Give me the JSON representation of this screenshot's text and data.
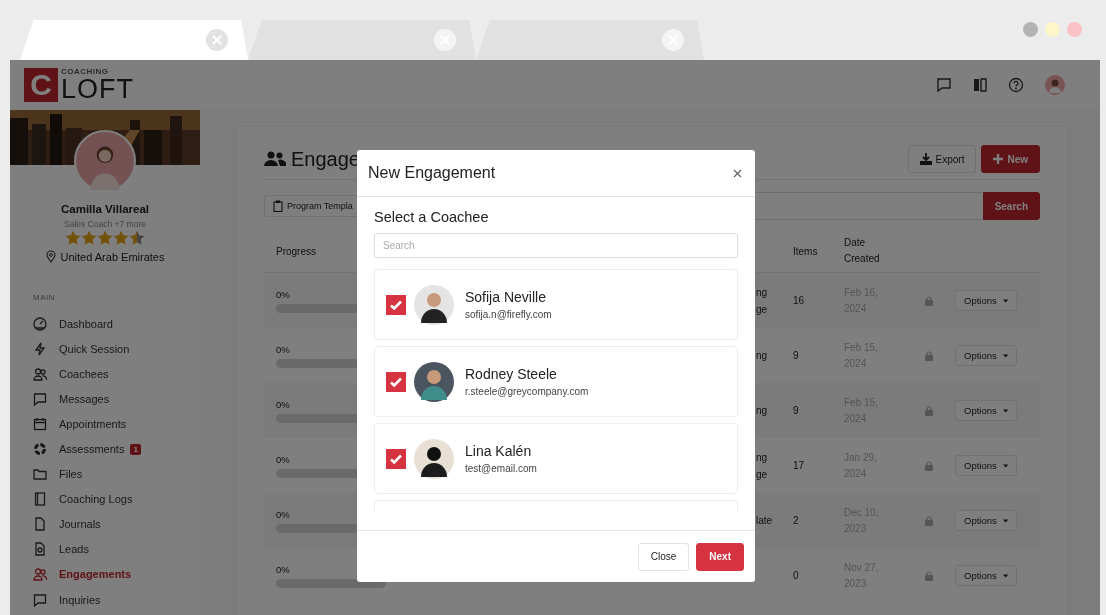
{
  "browser": {
    "tabs": [
      {
        "selected": true
      },
      {
        "selected": false
      },
      {
        "selected": false
      }
    ]
  },
  "logo": {
    "mark": "C",
    "top": "COACHING",
    "bottom": "LOFT"
  },
  "profile": {
    "name": "Camilla Villareal",
    "role": "Sales Coach +7 more",
    "stars": 4.5,
    "location": "United Arab Emirates"
  },
  "sidebar": {
    "section": "MAIN",
    "items": [
      {
        "label": "Dashboard",
        "selected": false
      },
      {
        "label": "Quick Session",
        "selected": false
      },
      {
        "label": "Coachees",
        "selected": false
      },
      {
        "label": "Messages",
        "selected": false
      },
      {
        "label": "Appointments",
        "selected": false
      },
      {
        "label": "Assessments",
        "selected": false,
        "badge": "1"
      },
      {
        "label": "Files",
        "selected": false
      },
      {
        "label": "Coaching Logs",
        "selected": false
      },
      {
        "label": "Journals",
        "selected": false
      },
      {
        "label": "Leads",
        "selected": false
      },
      {
        "label": "Engagements",
        "selected": true
      },
      {
        "label": "Inquiries",
        "selected": false
      }
    ]
  },
  "page": {
    "title": "Engage",
    "export": "Export",
    "new": "New",
    "template_button": "Program Templa",
    "search_button": "Search",
    "columns": {
      "progress": "Progress",
      "items": "Items",
      "date": "Date Created"
    },
    "rows": [
      {
        "progress": "0%",
        "level": 0,
        "column_3": [
          "ng",
          "ge"
        ],
        "items": "16",
        "date": "Feb 16, 2024",
        "options": "Options"
      },
      {
        "progress": "0%",
        "level": 0,
        "column_3": [
          "ng"
        ],
        "items": "9",
        "date": "Feb 15, 2024",
        "options": "Options"
      },
      {
        "progress": "0%",
        "level": 0,
        "column_3": [
          "ng"
        ],
        "items": "9",
        "date": "Feb 15, 2024",
        "options": "Options"
      },
      {
        "progress": "0%",
        "level": 0,
        "column_3": [
          "ng",
          "ge"
        ],
        "items": "17",
        "date": "Jan 29, 2024",
        "options": "Options"
      },
      {
        "progress": "0%",
        "level": 0,
        "column_3": [
          "late"
        ],
        "items": "2",
        "date": "Dec 10, 2023",
        "options": "Options"
      },
      {
        "progress": "0%",
        "level": 0,
        "column_3": [],
        "items": "0",
        "date": "Nov 27, 2023",
        "options": "Options"
      }
    ]
  },
  "modal": {
    "title": "New Engagement",
    "subtitle": "Select a Coachee",
    "search_placeholder": "Search",
    "coachees": [
      {
        "name": "Sofija Neville",
        "email": "sofija.n@firefly.com",
        "checked": true
      },
      {
        "name": "Rodney Steele",
        "email": "r.steele@greycompany.com",
        "checked": true
      },
      {
        "name": "Lina Kalén",
        "email": "test@email.com",
        "checked": true
      }
    ],
    "close": "Close",
    "next": "Next"
  }
}
